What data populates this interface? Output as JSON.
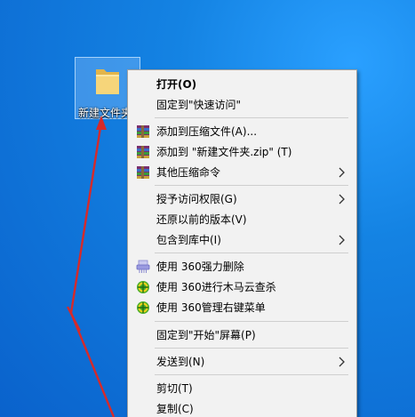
{
  "desktop": {
    "folder_label": "新建文件夹"
  },
  "menu": {
    "open": "打开(O)",
    "pin_quick_access": "固定到\"快速访问\"",
    "add_to_archive": "添加到压缩文件(A)...",
    "add_to_zip": "添加到 \"新建文件夹.zip\" (T)",
    "other_compress": "其他压缩命令",
    "grant_access": "授予访问权限(G)",
    "restore_versions": "还原以前的版本(V)",
    "include_library": "包含到库中(I)",
    "delete_360": "使用 360强力删除",
    "scan_360": "使用 360进行木马云查杀",
    "manage_360": "使用 360管理右键菜单",
    "pin_start": "固定到\"开始\"屏幕(P)",
    "send_to": "发送到(N)",
    "cut": "剪切(T)",
    "copy": "复制(C)"
  },
  "colors": {
    "annotation_arrow": "#d62a2a",
    "desktop_blue": "#1483e3"
  }
}
